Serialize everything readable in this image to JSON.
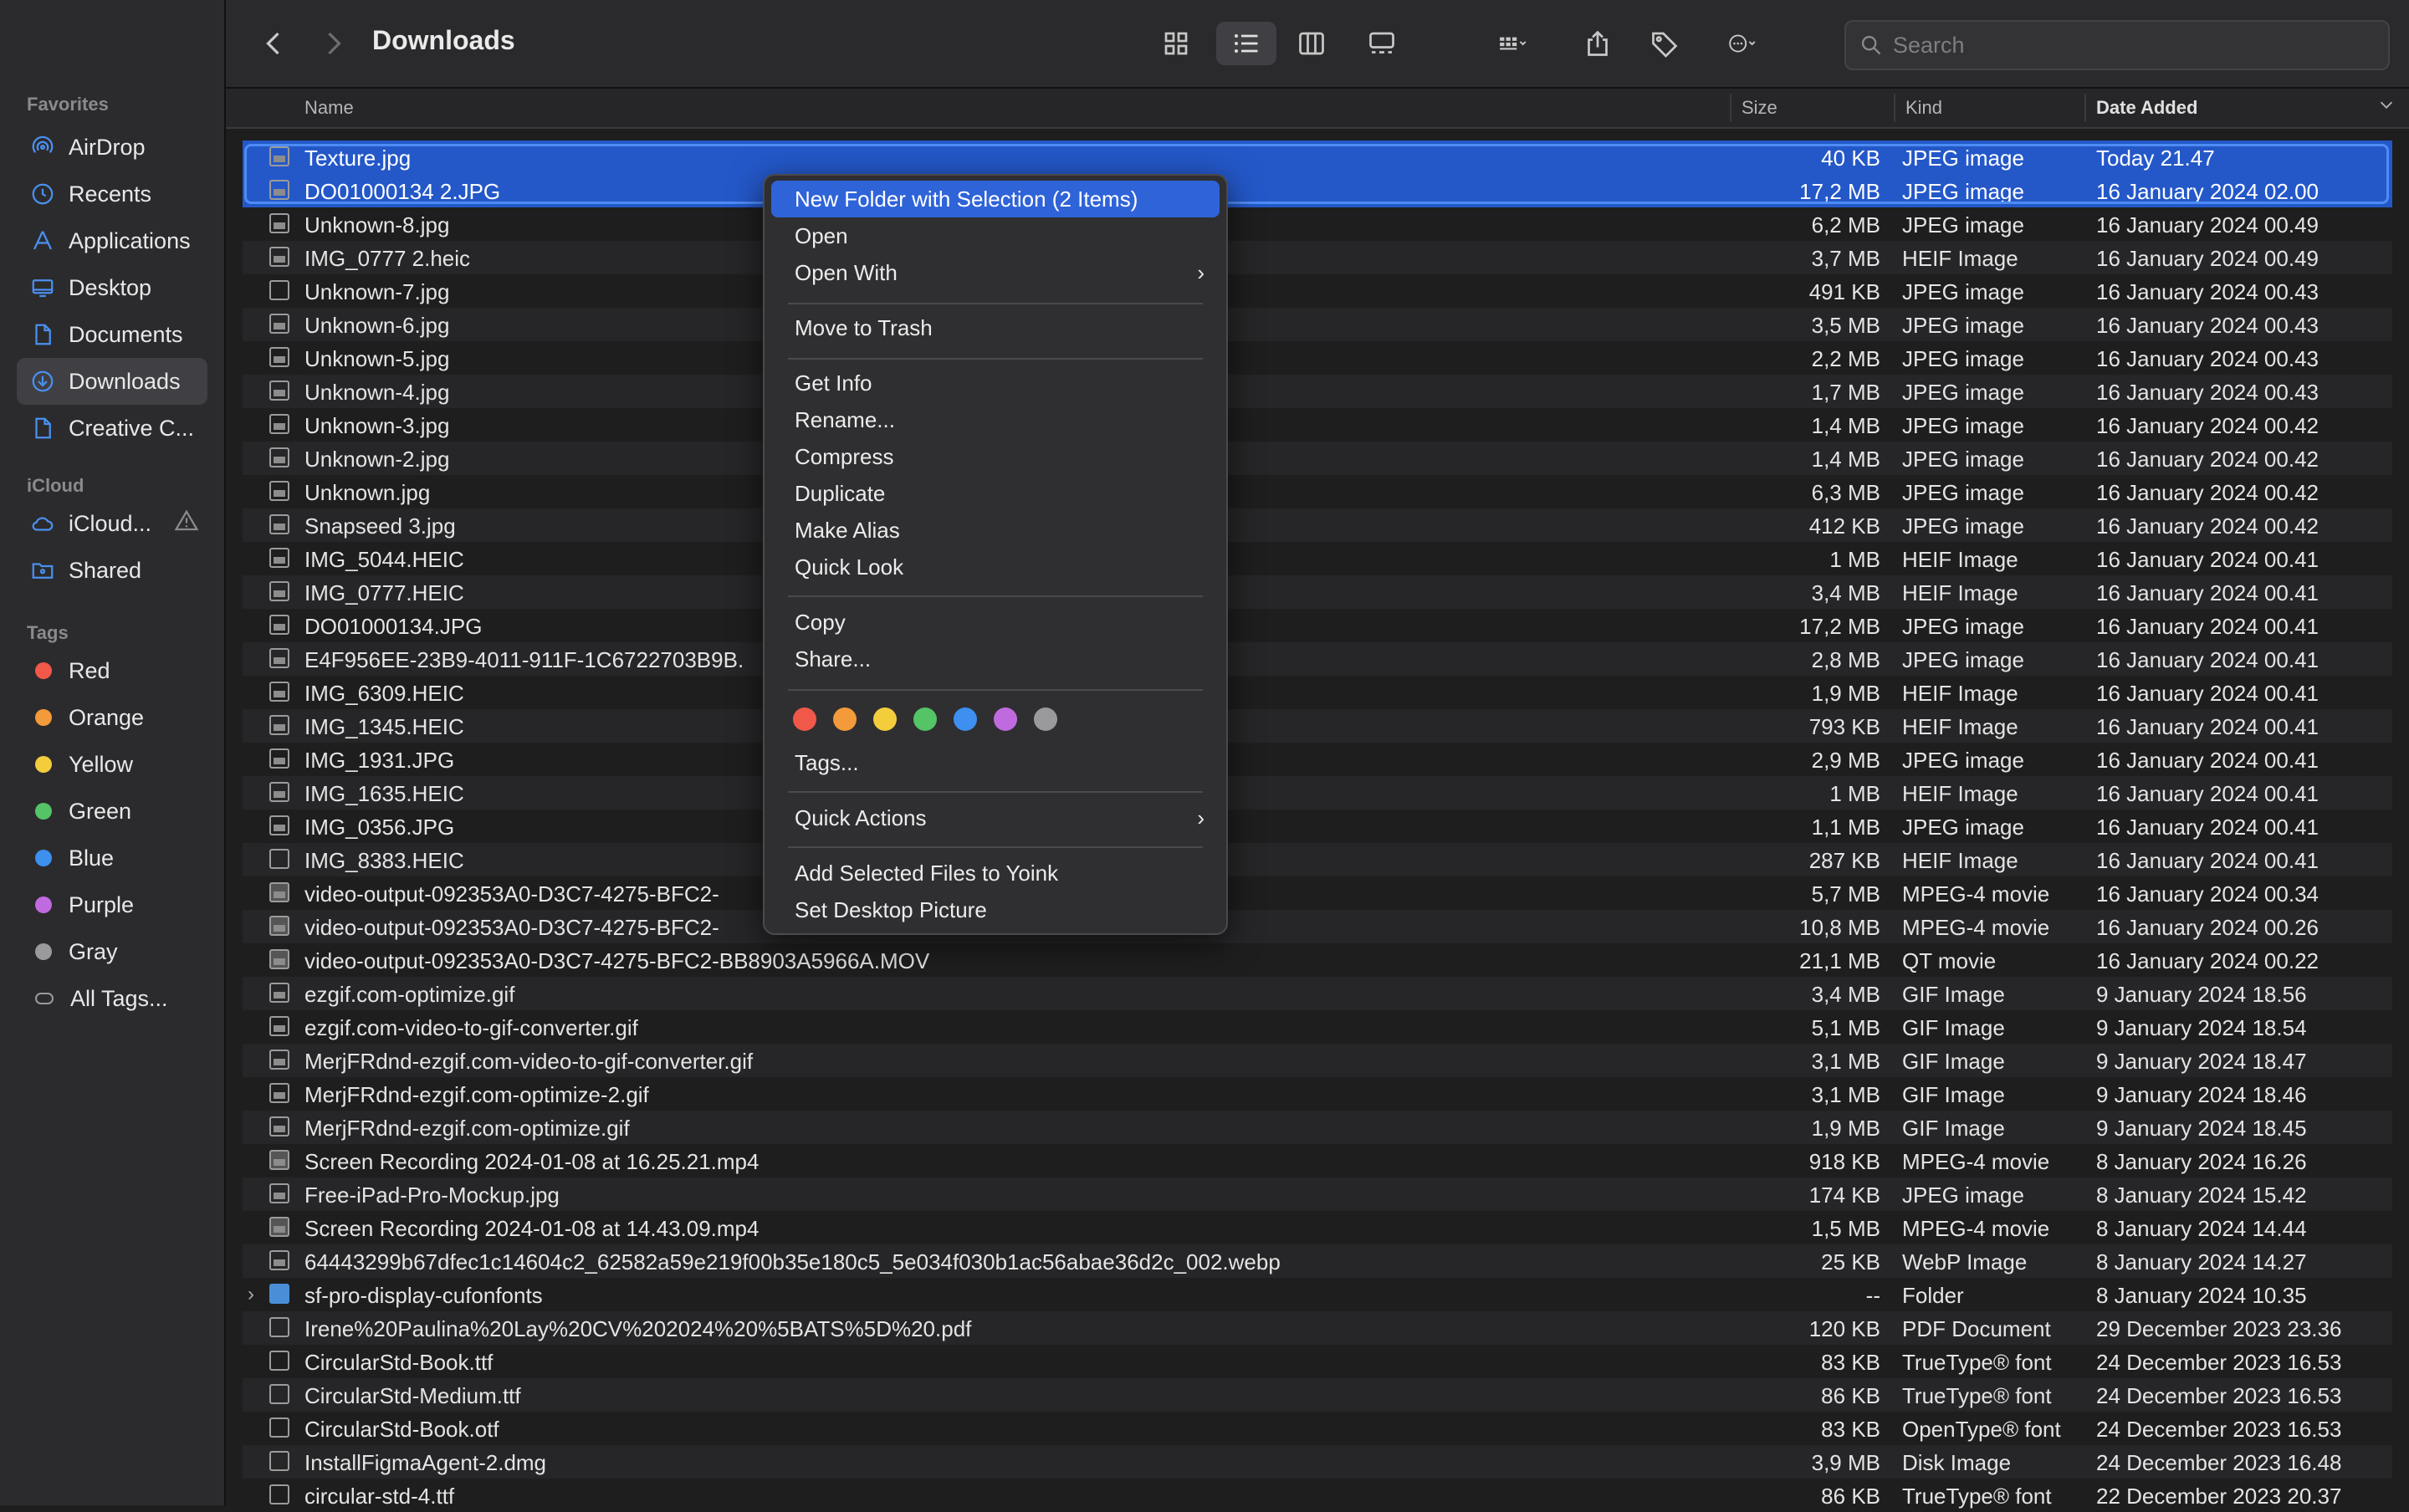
{
  "toolbar": {
    "title": "Downloads",
    "search_placeholder": "Search"
  },
  "sidebar": {
    "favorites_label": "Favorites",
    "favorites": [
      {
        "label": "AirDrop",
        "icon": "airdrop-icon"
      },
      {
        "label": "Recents",
        "icon": "clock-icon"
      },
      {
        "label": "Applications",
        "icon": "applications-icon"
      },
      {
        "label": "Desktop",
        "icon": "desktop-icon"
      },
      {
        "label": "Documents",
        "icon": "document-icon"
      },
      {
        "label": "Downloads",
        "icon": "downloads-icon"
      },
      {
        "label": "Creative C...",
        "icon": "document-icon"
      }
    ],
    "icloud_label": "iCloud",
    "icloud": [
      {
        "label": "iCloud...",
        "icon": "cloud-icon"
      },
      {
        "label": "Shared",
        "icon": "shared-folder-icon"
      }
    ],
    "tags_label": "Tags",
    "tags": [
      {
        "label": "Red",
        "color": "#f0584a"
      },
      {
        "label": "Orange",
        "color": "#f39a3a"
      },
      {
        "label": "Yellow",
        "color": "#f3cd3c"
      },
      {
        "label": "Green",
        "color": "#54c466"
      },
      {
        "label": "Blue",
        "color": "#3d8ff0"
      },
      {
        "label": "Purple",
        "color": "#c06ae0"
      },
      {
        "label": "Gray",
        "color": "#9a9a9d"
      },
      {
        "label": "All Tags...",
        "color": ""
      }
    ]
  },
  "columns": {
    "name": "Name",
    "size": "Size",
    "kind": "Kind",
    "date": "Date Added"
  },
  "files": [
    {
      "name": "Texture.jpg",
      "size": "40 KB",
      "kind": "JPEG image",
      "date": "Today 21.47",
      "icon": "img"
    },
    {
      "name": "DO01000134 2.JPG",
      "size": "17,2 MB",
      "kind": "JPEG image",
      "date": "16 January 2024 02.00",
      "icon": "img"
    },
    {
      "name": "Unknown-8.jpg",
      "size": "6,2 MB",
      "kind": "JPEG image",
      "date": "16 January 2024 00.49",
      "icon": "img"
    },
    {
      "name": "IMG_0777 2.heic",
      "size": "3,7 MB",
      "kind": "HEIF Image",
      "date": "16 January 2024 00.49",
      "icon": "img"
    },
    {
      "name": "Unknown-7.jpg",
      "size": "491 KB",
      "kind": "JPEG image",
      "date": "16 January 2024 00.43",
      "icon": "blank"
    },
    {
      "name": "Unknown-6.jpg",
      "size": "3,5 MB",
      "kind": "JPEG image",
      "date": "16 January 2024 00.43",
      "icon": "img"
    },
    {
      "name": "Unknown-5.jpg",
      "size": "2,2 MB",
      "kind": "JPEG image",
      "date": "16 January 2024 00.43",
      "icon": "img"
    },
    {
      "name": "Unknown-4.jpg",
      "size": "1,7 MB",
      "kind": "JPEG image",
      "date": "16 January 2024 00.43",
      "icon": "img"
    },
    {
      "name": "Unknown-3.jpg",
      "size": "1,4 MB",
      "kind": "JPEG image",
      "date": "16 January 2024 00.42",
      "icon": "img"
    },
    {
      "name": "Unknown-2.jpg",
      "size": "1,4 MB",
      "kind": "JPEG image",
      "date": "16 January 2024 00.42",
      "icon": "img"
    },
    {
      "name": "Unknown.jpg",
      "size": "6,3 MB",
      "kind": "JPEG image",
      "date": "16 January 2024 00.42",
      "icon": "img"
    },
    {
      "name": "Snapseed 3.jpg",
      "size": "412 KB",
      "kind": "JPEG image",
      "date": "16 January 2024 00.42",
      "icon": "img"
    },
    {
      "name": "IMG_5044.HEIC",
      "size": "1 MB",
      "kind": "HEIF Image",
      "date": "16 January 2024 00.41",
      "icon": "img"
    },
    {
      "name": "IMG_0777.HEIC",
      "size": "3,4 MB",
      "kind": "HEIF Image",
      "date": "16 January 2024 00.41",
      "icon": "img"
    },
    {
      "name": "DO01000134.JPG",
      "size": "17,2 MB",
      "kind": "JPEG image",
      "date": "16 January 2024 00.41",
      "icon": "img"
    },
    {
      "name": "E4F956EE-23B9-4011-911F-1C6722703B9B.",
      "size": "2,8 MB",
      "kind": "JPEG image",
      "date": "16 January 2024 00.41",
      "icon": "img"
    },
    {
      "name": "IMG_6309.HEIC",
      "size": "1,9 MB",
      "kind": "HEIF Image",
      "date": "16 January 2024 00.41",
      "icon": "img"
    },
    {
      "name": "IMG_1345.HEIC",
      "size": "793 KB",
      "kind": "HEIF Image",
      "date": "16 January 2024 00.41",
      "icon": "img"
    },
    {
      "name": "IMG_1931.JPG",
      "size": "2,9 MB",
      "kind": "JPEG image",
      "date": "16 January 2024 00.41",
      "icon": "img"
    },
    {
      "name": "IMG_1635.HEIC",
      "size": "1 MB",
      "kind": "HEIF Image",
      "date": "16 January 2024 00.41",
      "icon": "img"
    },
    {
      "name": "IMG_0356.JPG",
      "size": "1,1 MB",
      "kind": "JPEG image",
      "date": "16 January 2024 00.41",
      "icon": "img"
    },
    {
      "name": "IMG_8383.HEIC",
      "size": "287 KB",
      "kind": "HEIF Image",
      "date": "16 January 2024 00.41",
      "icon": "blank"
    },
    {
      "name": "video-output-092353A0-D3C7-4275-BFC2-",
      "size": "5,7 MB",
      "kind": "MPEG-4 movie",
      "date": "16 January 2024 00.34",
      "icon": "vid"
    },
    {
      "name": "video-output-092353A0-D3C7-4275-BFC2-",
      "size": "10,8 MB",
      "kind": "MPEG-4 movie",
      "date": "16 January 2024 00.26",
      "icon": "vid"
    },
    {
      "name": "video-output-092353A0-D3C7-4275-BFC2-BB8903A5966A.MOV",
      "size": "21,1 MB",
      "kind": "QT movie",
      "date": "16 January 2024 00.22",
      "icon": "vid"
    },
    {
      "name": "ezgif.com-optimize.gif",
      "size": "3,4 MB",
      "kind": "GIF Image",
      "date": "9 January 2024 18.56",
      "icon": "img"
    },
    {
      "name": "ezgif.com-video-to-gif-converter.gif",
      "size": "5,1 MB",
      "kind": "GIF Image",
      "date": "9 January 2024 18.54",
      "icon": "img"
    },
    {
      "name": "MerjFRdnd-ezgif.com-video-to-gif-converter.gif",
      "size": "3,1 MB",
      "kind": "GIF Image",
      "date": "9 January 2024 18.47",
      "icon": "img"
    },
    {
      "name": "MerjFRdnd-ezgif.com-optimize-2.gif",
      "size": "3,1 MB",
      "kind": "GIF Image",
      "date": "9 January 2024 18.46",
      "icon": "img"
    },
    {
      "name": "MerjFRdnd-ezgif.com-optimize.gif",
      "size": "1,9 MB",
      "kind": "GIF Image",
      "date": "9 January 2024 18.45",
      "icon": "img"
    },
    {
      "name": "Screen Recording 2024-01-08 at 16.25.21.mp4",
      "size": "918 KB",
      "kind": "MPEG-4 movie",
      "date": "8 January 2024 16.26",
      "icon": "vid"
    },
    {
      "name": "Free-iPad-Pro-Mockup.jpg",
      "size": "174 KB",
      "kind": "JPEG image",
      "date": "8 January 2024 15.42",
      "icon": "img"
    },
    {
      "name": "Screen Recording 2024-01-08 at 14.43.09.mp4",
      "size": "1,5 MB",
      "kind": "MPEG-4 movie",
      "date": "8 January 2024 14.44",
      "icon": "vid"
    },
    {
      "name": "64443299b67dfec1c14604c2_62582a59e219f00b35e180c5_5e034f030b1ac56abae36d2c_002.webp",
      "size": "25 KB",
      "kind": "WebP Image",
      "date": "8 January 2024 14.27",
      "icon": "img"
    },
    {
      "name": "sf-pro-display-cufonfonts",
      "size": "--",
      "kind": "Folder",
      "date": "8 January 2024 10.35",
      "icon": "folder"
    },
    {
      "name": "Irene%20Paulina%20Lay%20CV%202024%20%5BATS%5D%20.pdf",
      "size": "120 KB",
      "kind": "PDF Document",
      "date": "29 December 2023 23.36",
      "icon": "blank"
    },
    {
      "name": "CircularStd-Book.ttf",
      "size": "83 KB",
      "kind": "TrueType® font",
      "date": "24 December 2023 16.53",
      "icon": "blank"
    },
    {
      "name": "CircularStd-Medium.ttf",
      "size": "86 KB",
      "kind": "TrueType® font",
      "date": "24 December 2023 16.53",
      "icon": "blank"
    },
    {
      "name": "CircularStd-Book.otf",
      "size": "83 KB",
      "kind": "OpenType® font",
      "date": "24 December 2023 16.53",
      "icon": "blank"
    },
    {
      "name": "InstallFigmaAgent-2.dmg",
      "size": "3,9 MB",
      "kind": "Disk Image",
      "date": "24 December 2023 16.48",
      "icon": "blank"
    },
    {
      "name": "circular-std-4.ttf",
      "size": "86 KB",
      "kind": "TrueType® font",
      "date": "22 December 2023 20.37",
      "icon": "blank"
    }
  ],
  "context_menu": {
    "new_folder": "New Folder with Selection (2 Items)",
    "open": "Open",
    "open_with": "Open With",
    "move_to_trash": "Move to Trash",
    "get_info": "Get Info",
    "rename": "Rename...",
    "compress": "Compress",
    "duplicate": "Duplicate",
    "make_alias": "Make Alias",
    "quick_look": "Quick Look",
    "copy": "Copy",
    "share": "Share...",
    "tag_colors": [
      "#f0584a",
      "#f39a3a",
      "#f3cd3c",
      "#54c466",
      "#3d8ff0",
      "#c06ae0",
      "#9a9a9d"
    ],
    "tags": "Tags...",
    "quick_actions": "Quick Actions",
    "add_to_yoink": "Add Selected Files to Yoink",
    "set_desktop_picture": "Set Desktop Picture"
  }
}
